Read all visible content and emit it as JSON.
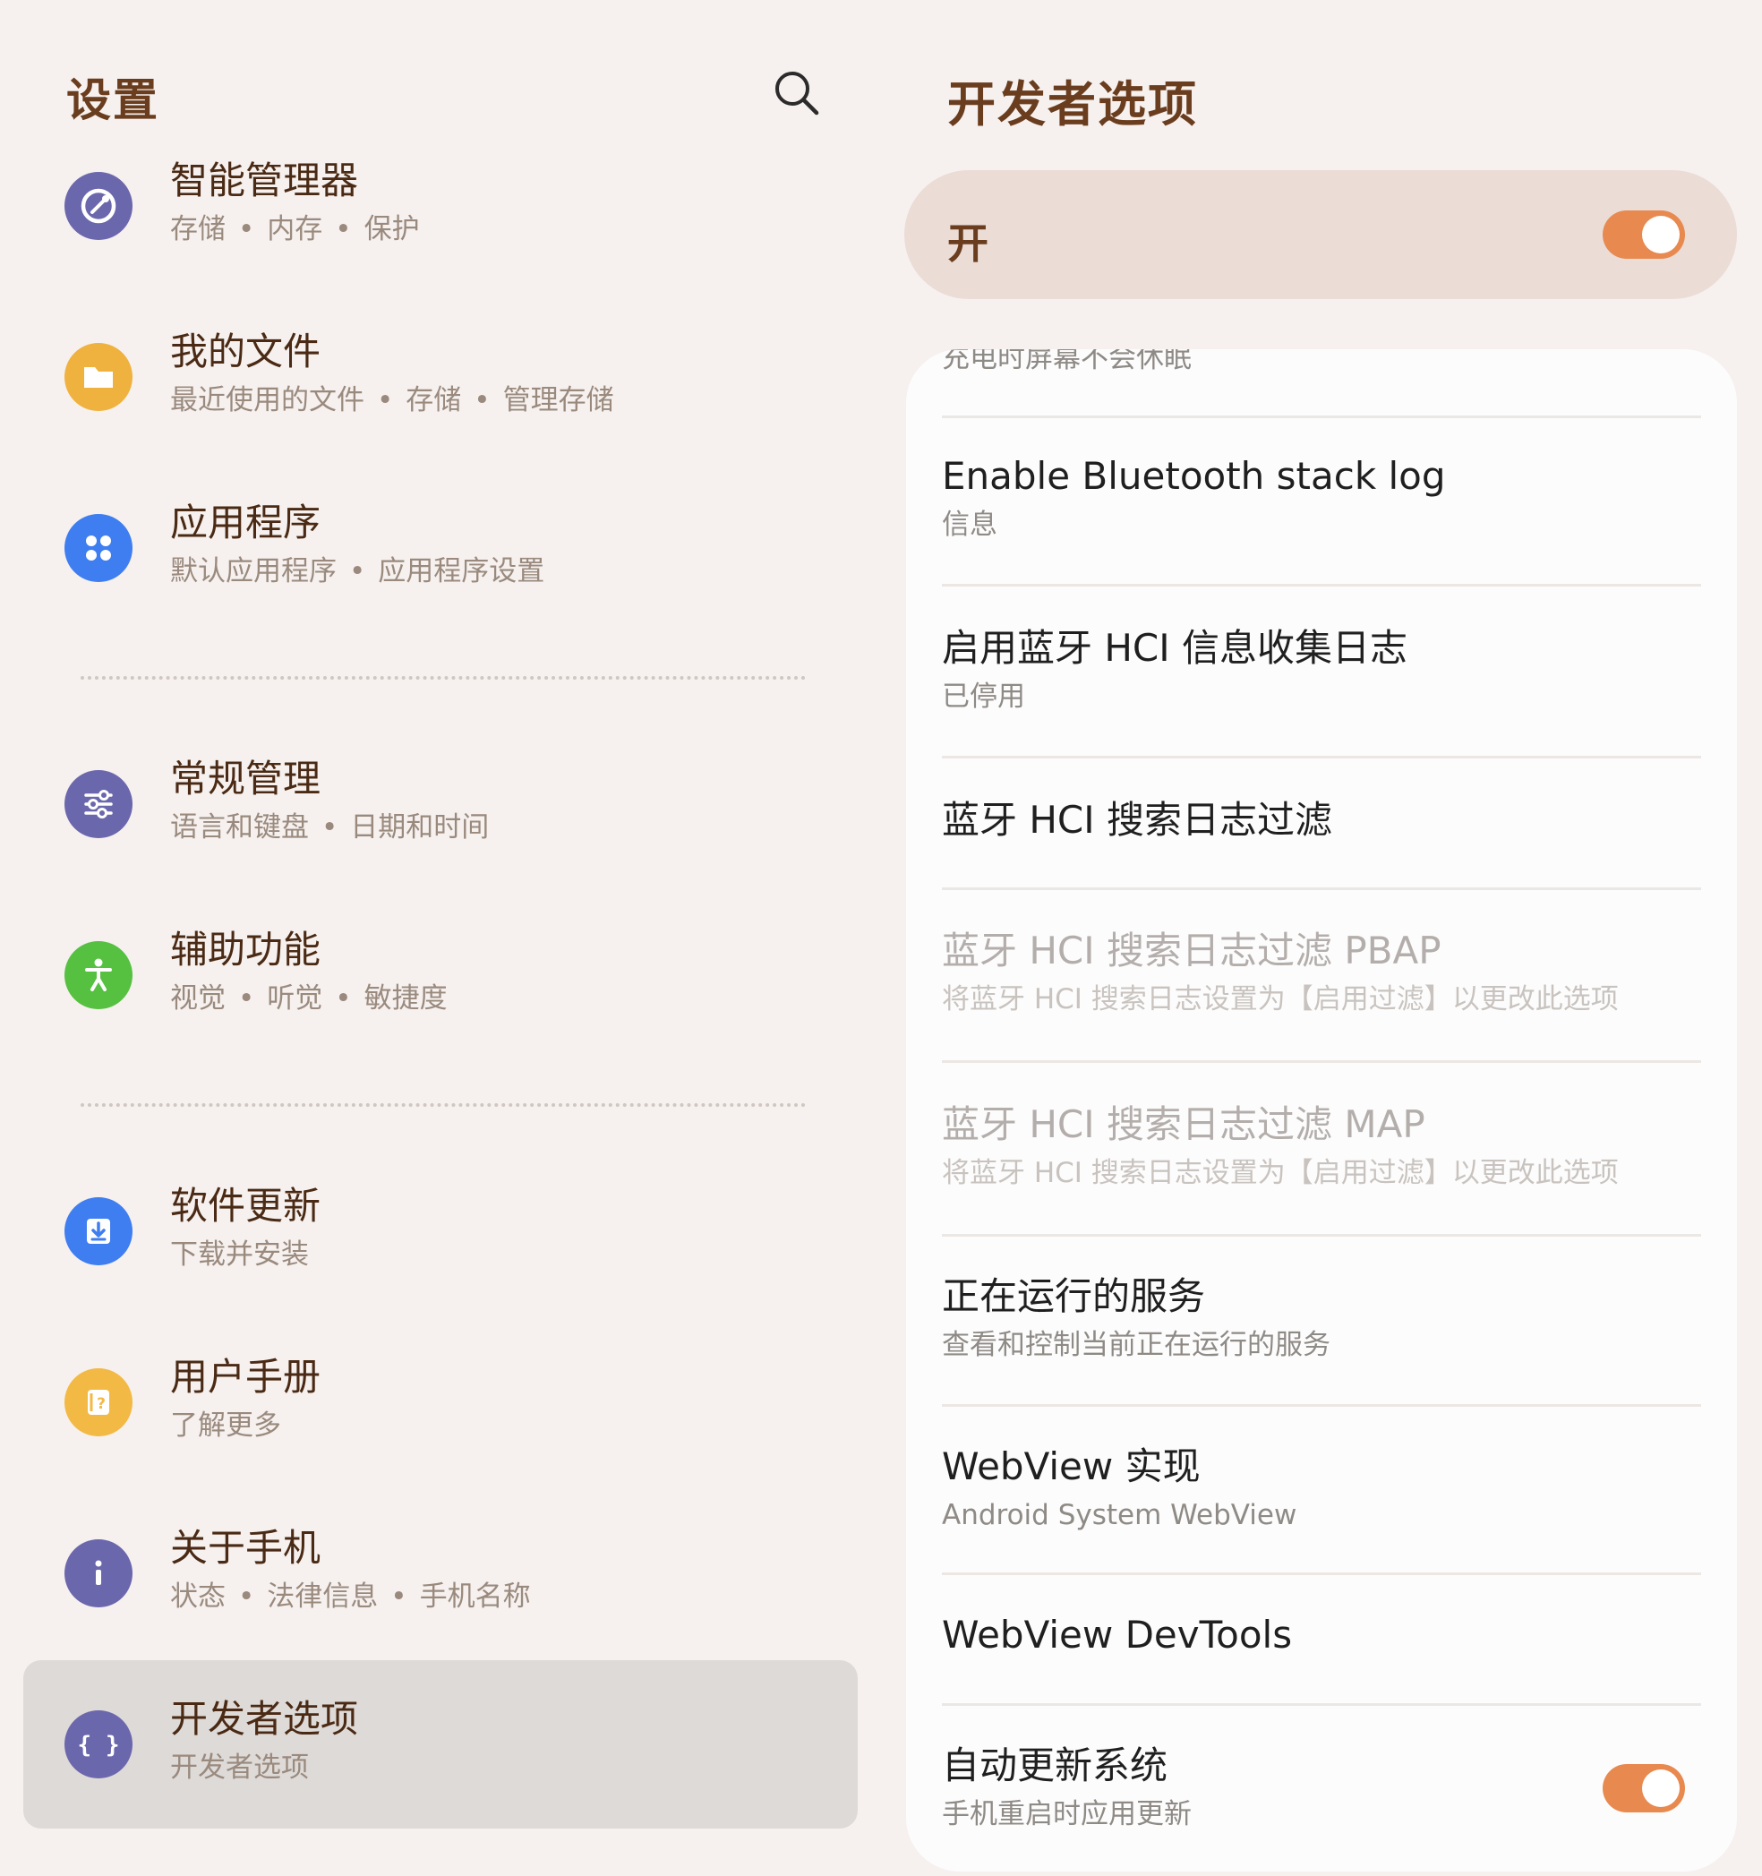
{
  "left": {
    "title": "设置",
    "items": [
      {
        "title": "智能管理器",
        "sub": [
          "存储",
          "内存",
          "保护"
        ]
      },
      {
        "title": "我的文件",
        "sub": [
          "最近使用的文件",
          "存储",
          "管理存储"
        ]
      },
      {
        "title": "应用程序",
        "sub": [
          "默认应用程序",
          "应用程序设置"
        ]
      },
      {
        "title": "常规管理",
        "sub": [
          "语言和键盘",
          "日期和时间"
        ]
      },
      {
        "title": "辅助功能",
        "sub": [
          "视觉",
          "听觉",
          "敏捷度"
        ]
      },
      {
        "title": "软件更新",
        "sub": [
          "下载并安装"
        ]
      },
      {
        "title": "用户手册",
        "sub": [
          "了解更多"
        ]
      },
      {
        "title": "关于手机",
        "sub": [
          "状态",
          "法律信息",
          "手机名称"
        ]
      },
      {
        "title": "开发者选项",
        "sub": [
          "开发者选项"
        ]
      }
    ],
    "dot_separator": "•"
  },
  "right": {
    "title": "开发者选项",
    "master_label": "开",
    "clipped_row_text": "充电时屏幕不会休眠",
    "rows": [
      {
        "title": "Enable Bluetooth stack log",
        "sub": "信息"
      },
      {
        "title": "启用蓝牙 HCI 信息收集日志",
        "sub": "已停用"
      },
      {
        "title": "蓝牙 HCI 搜索日志过滤",
        "sub": ""
      },
      {
        "title": "蓝牙 HCI 搜索日志过滤 PBAP",
        "sub": "将蓝牙 HCI 搜索日志设置为【启用过滤】以更改此选项"
      },
      {
        "title": "蓝牙 HCI 搜索日志过滤 MAP",
        "sub": "将蓝牙 HCI 搜索日志设置为【启用过滤】以更改此选项"
      },
      {
        "title": "正在运行的服务",
        "sub": "查看和控制当前正在运行的服务"
      },
      {
        "title": "WebView 实现",
        "sub": "Android System WebView"
      },
      {
        "title": "WebView DevTools",
        "sub": ""
      },
      {
        "title": "自动更新系统",
        "sub": "手机重启时应用更新"
      }
    ]
  },
  "colors": {
    "background": "#f6f1ef",
    "title_brown": "#6a3d1e",
    "toggle_on": "#e8894f",
    "master_card": "#ebdcd6",
    "icon_smart": "#6b67ad",
    "icon_files": "#f0b23e",
    "icon_apps": "#3f7ef0",
    "icon_general": "#6b67ad",
    "icon_access": "#56c141",
    "icon_update": "#3f7ef0",
    "icon_manual": "#f3b945",
    "icon_about": "#6b67ad",
    "icon_dev": "#6b67ad"
  }
}
